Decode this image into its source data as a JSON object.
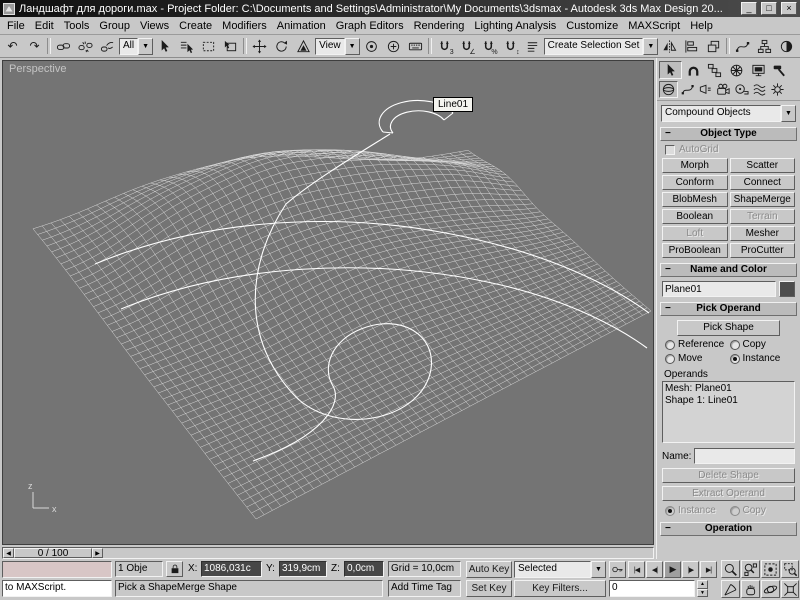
{
  "window": {
    "title": "Ландшафт для дороги.max    - Project Folder: C:\\Documents and Settings\\Administrator\\My Documents\\3dsmax    -    Autodesk 3ds Max Design 20...",
    "min": "_",
    "max": "□",
    "close": "×"
  },
  "menubar": {
    "items": [
      "File",
      "Edit",
      "Tools",
      "Group",
      "Views",
      "Create",
      "Modifiers",
      "Animation",
      "Graph Editors",
      "Rendering",
      "Lighting Analysis",
      "Customize",
      "MAXScript",
      "Help"
    ]
  },
  "ui": {
    "dropdown_arrow": "▼",
    "minus": "−",
    "spin_up": "▲",
    "spin_down": "▼"
  },
  "toolbar": {
    "undo": "↶",
    "redo": "↷",
    "filter_value": "All",
    "coord_value": "View",
    "selset_value": "Create Selection Set",
    "snap_badges": [
      "3",
      "∠",
      "%",
      "↕"
    ],
    "icons": [
      "undo",
      "redo",
      "select-link",
      "unlink-selection",
      "bind-to-space-warp",
      "selection-filter",
      "select-object",
      "select-by-name",
      "rectangular-selection-region",
      "window-crossing",
      "select-and-move",
      "select-and-rotate",
      "select-and-scale",
      "reference-coordinate-system",
      "use-pivot-point-center",
      "select-and-manipulate",
      "keyboard-shortcut-override",
      "snaps-toggle",
      "angle-snap",
      "percent-snap",
      "spinner-snap",
      "edit-named-selection-sets",
      "named-selection-sets",
      "mirror",
      "align",
      "layer-manager",
      "curve-editor",
      "schematic-view",
      "material-editor",
      "render-setup",
      "rendered-frame-window",
      "quick-render"
    ]
  },
  "viewport": {
    "label": "Perspective",
    "tooltip": "Line01",
    "axis_z": "z",
    "axis_x": "x"
  },
  "cp": {
    "dropdown": "Compound Objects",
    "object_type": {
      "title": "Object Type",
      "autogrid": "AutoGrid",
      "btns": [
        "Morph",
        "Scatter",
        "Conform",
        "Connect",
        "BlobMesh",
        "ShapeMerge",
        "Boolean",
        "Terrain",
        "Loft",
        "Mesher",
        "ProBoolean",
        "ProCutter"
      ]
    },
    "name_color": {
      "title": "Name and Color",
      "value": "Plane01"
    },
    "pick": {
      "title": "Pick Operand",
      "button": "Pick Shape",
      "radios": [
        "Reference",
        "Copy",
        "Move",
        "Instance"
      ],
      "selected": "Instance",
      "operands_title": "Operands",
      "operands": [
        "Mesh: Plane01",
        "Shape 1: Line01"
      ],
      "name_label": "Name:",
      "name_value": "",
      "delete": "Delete Shape",
      "extract": "Extract Operand",
      "clone": [
        "Instance",
        "Copy"
      ]
    },
    "operation": {
      "title": "Operation"
    }
  },
  "time_slider": {
    "handle": "0 / 100",
    "left_arrow": "◀",
    "right_arrow": "▶"
  },
  "status": {
    "listener": "to MAXScript.",
    "selection": "1 Obje",
    "x_label": "X:",
    "x": "1086,031c",
    "y_label": "Y:",
    "y": "319,9cm",
    "z_label": "Z:",
    "z": "0,0cm",
    "grid": "Grid = 10,0cm",
    "prompt": "Pick a ShapeMerge Shape",
    "time_tag": "Add Time Tag"
  },
  "anim": {
    "auto_key": "Auto Key",
    "set_key": "Set Key",
    "mode": "Selected",
    "key_filters": "Key Filters...",
    "frame": "0",
    "playback": [
      "|◀",
      "◀|",
      "▶",
      "|▶",
      "▶|"
    ],
    "nav_icons": [
      "zoom",
      "zoom-all",
      "zoom-extents",
      "zoom-region",
      "field-of-view",
      "pan",
      "arc-rotate",
      "maximize-viewport-toggle"
    ]
  },
  "colors": {
    "viewport_bg": "#747474",
    "wireframe": "#d9d9d9",
    "spline": "#ffffff",
    "ui_face": "#c8c8c8",
    "macro_recorder": "#d8c6c6"
  }
}
